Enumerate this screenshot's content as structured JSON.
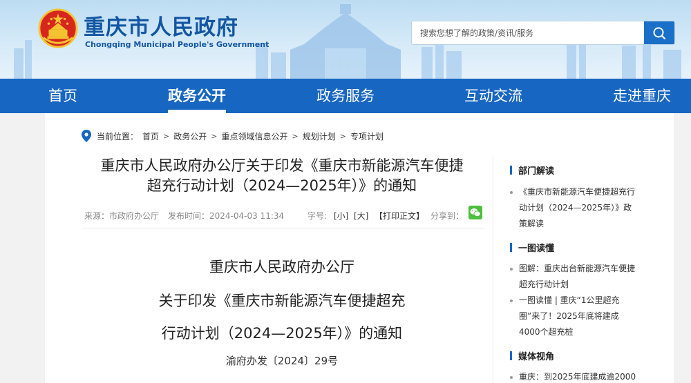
{
  "header": {
    "title": "重庆市人民政府",
    "subtitle": "Chongqing Municipal People's Government",
    "search_placeholder": "搜索您想了解的政策/资讯/服务"
  },
  "nav": {
    "items": [
      {
        "label": "首页"
      },
      {
        "label": "政务公开"
      },
      {
        "label": "政务服务"
      },
      {
        "label": "互动交流"
      },
      {
        "label": "走进重庆"
      }
    ],
    "active": "政务公开"
  },
  "breadcrumb": {
    "prefix": "当前位置：",
    "items": [
      "首页",
      "政务公开",
      "重点领域信息公开",
      "规划计划",
      "专项计划"
    ],
    "separator": ">"
  },
  "article": {
    "title_line1": "重庆市人民政府办公厅关于印发《重庆市新能源汽车便捷",
    "title_line2": "超充行动计划（2024—2025年）》的通知",
    "source": "来源：市政府办公厅",
    "published": "发布时间：2024-04-03 11:34",
    "font_label": "字号:",
    "font_small": "[小]",
    "font_large": "[大]",
    "print": "【打印正文】",
    "share_label": "分享到："
  },
  "document": {
    "line1": "重庆市人民政府办公厅",
    "line2": "关于印发《重庆市新能源汽车便捷超充",
    "line3": "行动计划（2024—2025年）》的通知",
    "number": "渝府办发〔2024〕29号"
  },
  "sidebar": {
    "sections": [
      {
        "heading": "部门解读",
        "items": [
          {
            "line1": "《重庆市新能源汽车便捷超充行",
            "line2": "动计划（2024—2025年）》政",
            "line3": "策解读"
          }
        ]
      },
      {
        "heading": "一图读懂",
        "items": [
          {
            "line1": "图解：重庆出台新能源汽车便捷",
            "line2": "超充行动计划"
          },
          {
            "line1": "一图读懂 | 重庆“1公里超充",
            "line2": "圈”来了！2025年底将建成",
            "line3": "4000个超充桩"
          }
        ]
      },
      {
        "heading": "媒体视角",
        "items": [
          {
            "line1": "重庆：到2025年底建成逾2000"
          }
        ]
      }
    ]
  },
  "colors": {
    "brand_blue": "#1766c2",
    "title_blue": "#1356a3",
    "emblem_red": "#d7261e",
    "emblem_gold": "#f4c430",
    "wechat_green": "#4cbf3c"
  }
}
